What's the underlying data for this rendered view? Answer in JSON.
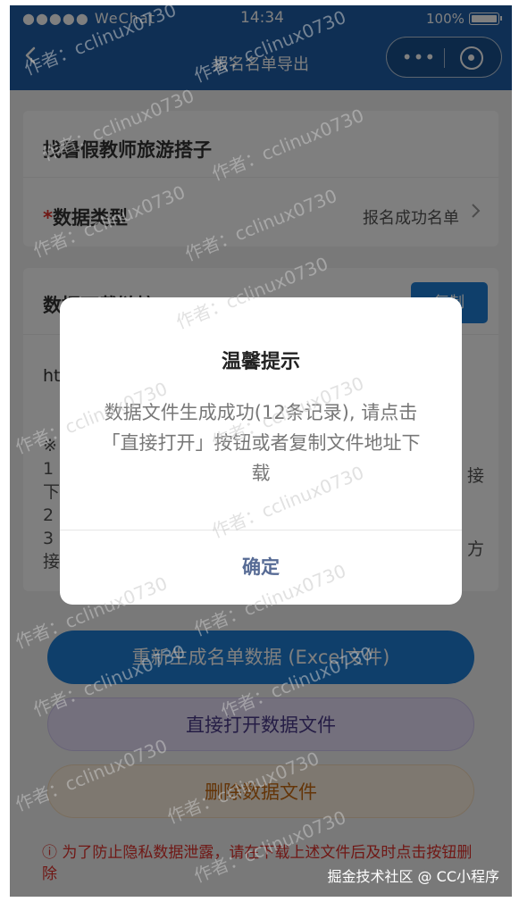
{
  "status_bar": {
    "signal": "●●●●● WeChat",
    "time": "14:34",
    "battery_pct": "100%"
  },
  "nav": {
    "title": "报名名单导出",
    "more_glyph": "•••"
  },
  "event_card": {
    "title": "找暑假教师旅游搭子",
    "type_required_mark": "*",
    "type_label": "数据类型",
    "type_value": "报名成功名单"
  },
  "download_card": {
    "title": "数据下载链接",
    "copy_label": "复制",
    "url_fragment": "ht",
    "notes_fragments": [
      "※",
      "1",
      "下",
      "2",
      "3",
      "接"
    ],
    "right_fragments": [
      "接",
      "方"
    ]
  },
  "buttons": {
    "regenerate": "重新生成名单数据 (Excel文件)",
    "open_file": "直接打开数据文件",
    "delete_file": "删除数据文件"
  },
  "warning": "ⓘ 为了防止隐私数据泄露，请在下载上述文件后及时点击按钮删除",
  "footer_tag": "掘金技术社区 @ CC小程序",
  "modal": {
    "title": "温馨提示",
    "body": "数据文件生成成功(12条记录), 请点击「直接打开」按钮或者复制文件地址下载",
    "confirm": "确定"
  },
  "watermark": {
    "text": "作者：cclinux0730"
  },
  "colors": {
    "nav_bg": "#1e5fa8",
    "primary": "#1f7fd6",
    "danger": "#e0302b",
    "confirm": "#576b95"
  }
}
